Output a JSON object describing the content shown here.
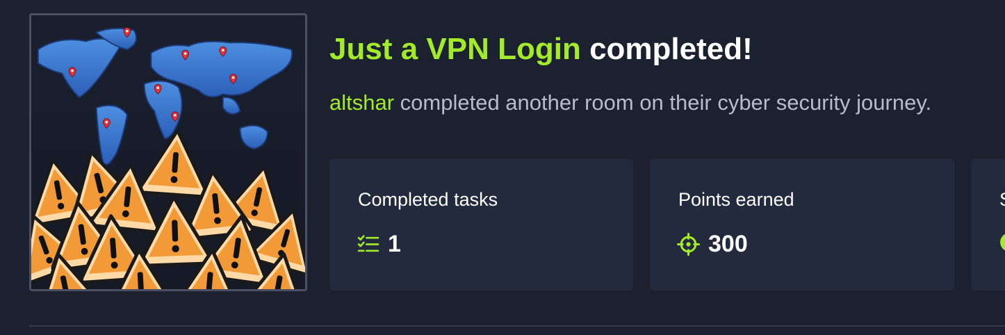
{
  "room": {
    "name": "Just a VPN Login",
    "completed_text": "completed!",
    "image_icon": "world-map-warning-signs"
  },
  "subtitle": {
    "username": "altshar",
    "text": "completed another room on their cyber security journey."
  },
  "stats": [
    {
      "label": "Completed tasks",
      "value": "1",
      "icon": "checklist-icon"
    },
    {
      "label": "Points earned",
      "value": "300",
      "icon": "target-icon"
    },
    {
      "label": "S",
      "value": "",
      "icon": "circle-icon"
    }
  ],
  "colors": {
    "accent": "#a3ea2a",
    "background": "#1c2130",
    "card": "#232a3e"
  }
}
